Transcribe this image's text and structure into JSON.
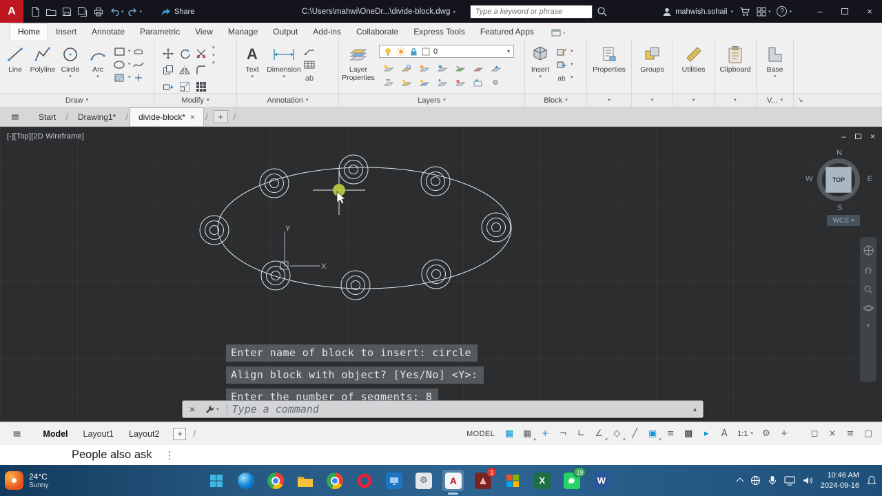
{
  "titlebar": {
    "share_label": "Share",
    "file_path": "C:\\Users\\mahwi\\OneDr...\\divide-block.dwg",
    "search_placeholder": "Type a keyword or phrase",
    "username": "mahwish.sohail"
  },
  "ribbon_tabs": {
    "items": [
      "Home",
      "Insert",
      "Annotate",
      "Parametric",
      "View",
      "Manage",
      "Output",
      "Add-ins",
      "Collaborate",
      "Express Tools",
      "Featured Apps"
    ]
  },
  "ribbon": {
    "tools": {
      "line": "Line",
      "polyline": "Polyline",
      "circle": "Circle",
      "arc": "Arc",
      "text": "Text",
      "dimension": "Dimension",
      "layer_properties": "Layer Properties",
      "insert": "Insert",
      "properties": "Properties",
      "groups": "Groups",
      "utilities": "Utilities",
      "clipboard": "Clipboard",
      "base": "Base"
    },
    "layer_current": "0",
    "panel_labels": {
      "draw": "Draw",
      "modify": "Modify",
      "annotation": "Annotation",
      "layers": "Layers",
      "block": "Block",
      "view_truncated": "V..."
    }
  },
  "file_tabs": {
    "start": "Start",
    "drawing1": "Drawing1*",
    "active": "divide-block*"
  },
  "viewport": {
    "corner_label": "[-][Top][2D Wireframe]",
    "ucs": {
      "x": "X",
      "y": "Y"
    },
    "viewcube": {
      "n": "N",
      "s": "S",
      "e": "E",
      "w": "W",
      "top": "TOP",
      "wcs": "WCS"
    },
    "command_history": [
      "Enter name of block to insert: circle",
      "Align block with object? [Yes/No] <Y>:",
      "Enter the number of segments: 8"
    ],
    "command_placeholder": "Type a command"
  },
  "statusbar": {
    "model_tab": "Model",
    "layout1_tab": "Layout1",
    "layout2_tab": "Layout2",
    "model_badge": "MODEL",
    "scale": "1:1"
  },
  "strip": {
    "text": "People also ask"
  },
  "taskbar": {
    "temperature": "24°C",
    "weather": "Sunny",
    "whatsapp_badge": "19",
    "alert_badge": "1",
    "time": "10:46 AM",
    "date": "2024-09-16"
  }
}
